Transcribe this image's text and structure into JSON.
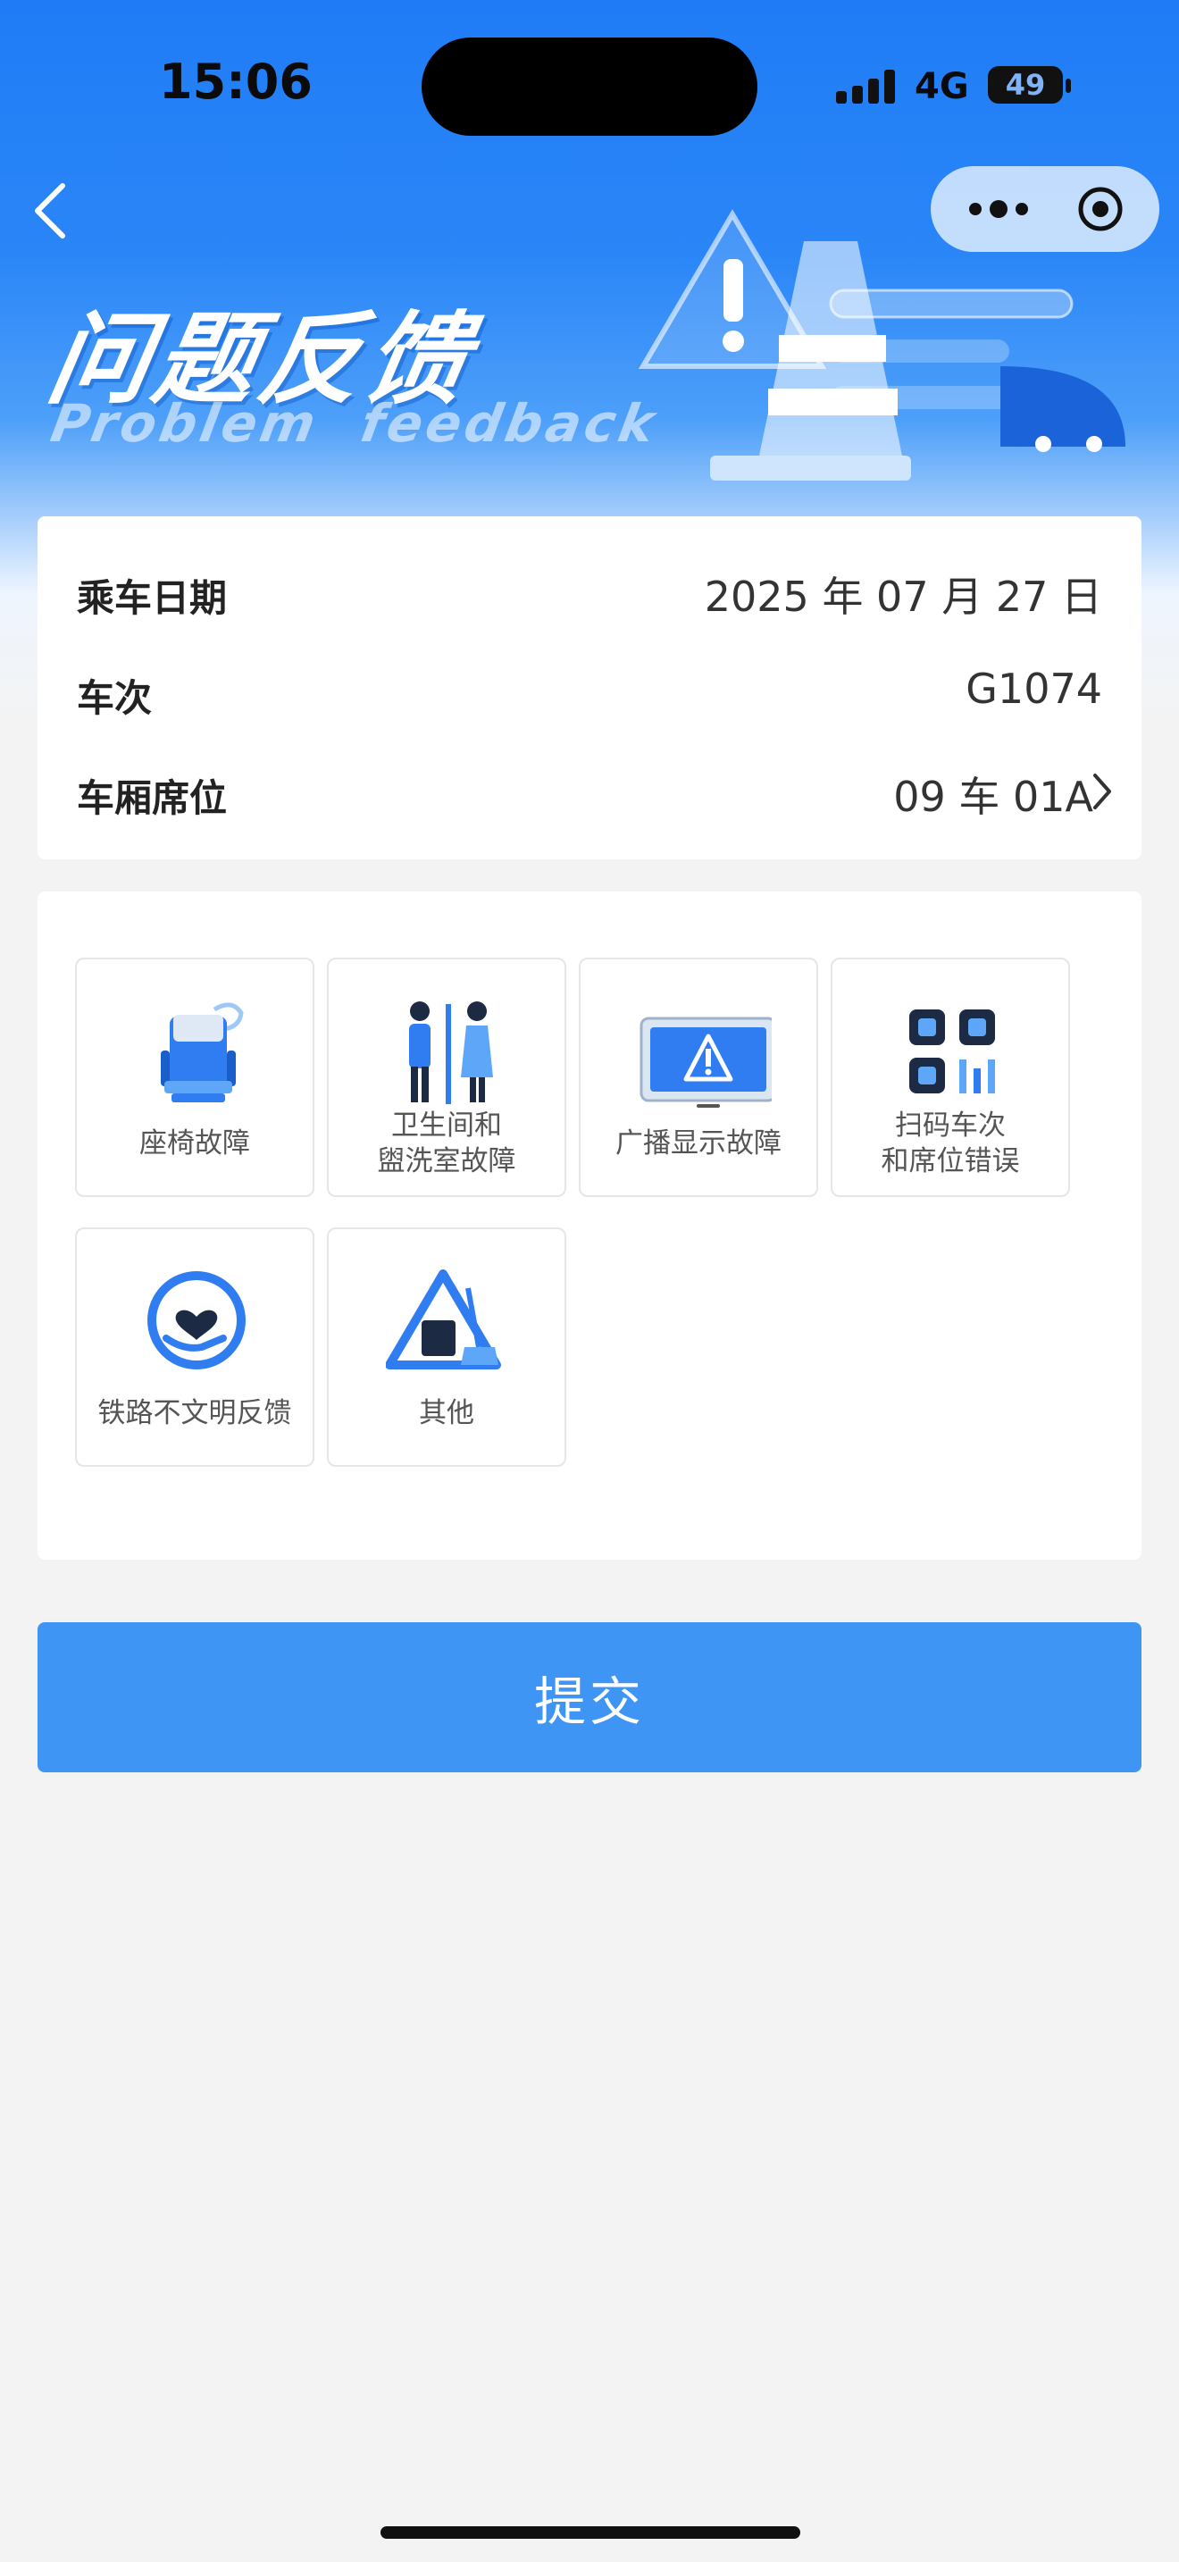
{
  "status_bar": {
    "time": "15:06",
    "network": "4G",
    "battery": "49"
  },
  "header": {
    "title": "问题反馈",
    "subtitle": "Problem  feedback"
  },
  "info": {
    "date_label": "乘车日期",
    "date_value": "2025 年 07 月 27 日",
    "train_label": "车次",
    "train_value": "G1074",
    "seat_label": "车厢席位",
    "seat_value": "09 车 01A"
  },
  "categories": [
    {
      "label": "座椅故障",
      "icon": "seat-icon"
    },
    {
      "label_line1": "卫生间和",
      "label_line2": "盥洗室故障",
      "icon": "restroom-icon"
    },
    {
      "label": "广播显示故障",
      "icon": "display-warning-icon"
    },
    {
      "label_line1": "扫码车次",
      "label_line2": "和席位错误",
      "icon": "qr-code-icon"
    },
    {
      "label": "铁路不文明反馈",
      "icon": "heart-hand-icon"
    },
    {
      "label": "其他",
      "icon": "cleaning-warning-icon"
    }
  ],
  "submit_label": "提交",
  "colors": {
    "primary": "#3f95f3",
    "hero_top": "#1f7cf6",
    "page_bg": "#f3f3f3"
  }
}
